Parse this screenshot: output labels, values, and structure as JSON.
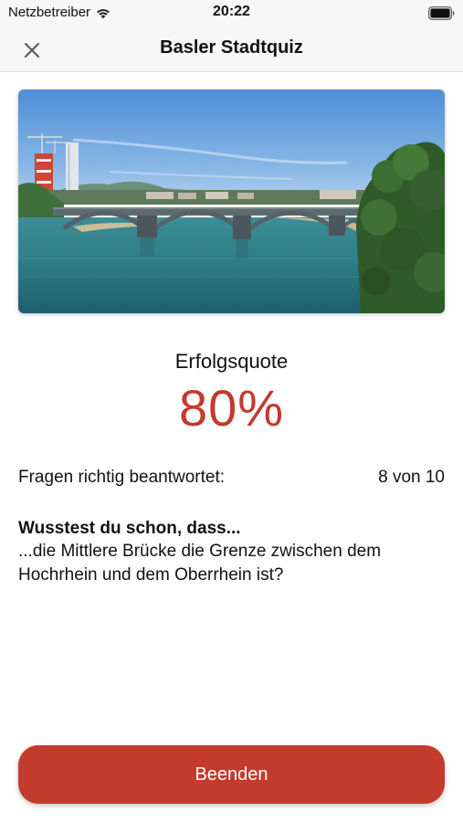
{
  "status_bar": {
    "carrier": "Netzbetreiber",
    "time": "20:22",
    "icons": [
      "wifi-icon",
      "battery-icon"
    ]
  },
  "nav": {
    "title": "Basler Stadtquiz",
    "close_icon": "close-icon"
  },
  "photo": {
    "subject": "Mittlere Brücke über den Rhein in Basel"
  },
  "result": {
    "label": "Erfolgsquote",
    "value": "80%",
    "accent_color": "#c43a2c"
  },
  "stats": {
    "label": "Fragen richtig beantwortet:",
    "value": "8 von 10"
  },
  "fact": {
    "heading": "Wusstest du schon, dass...",
    "text": "...die Mittlere Brücke die Grenze zwischen dem Hochrhein und dem Oberrhein ist?"
  },
  "actions": {
    "finish_label": "Beenden"
  }
}
